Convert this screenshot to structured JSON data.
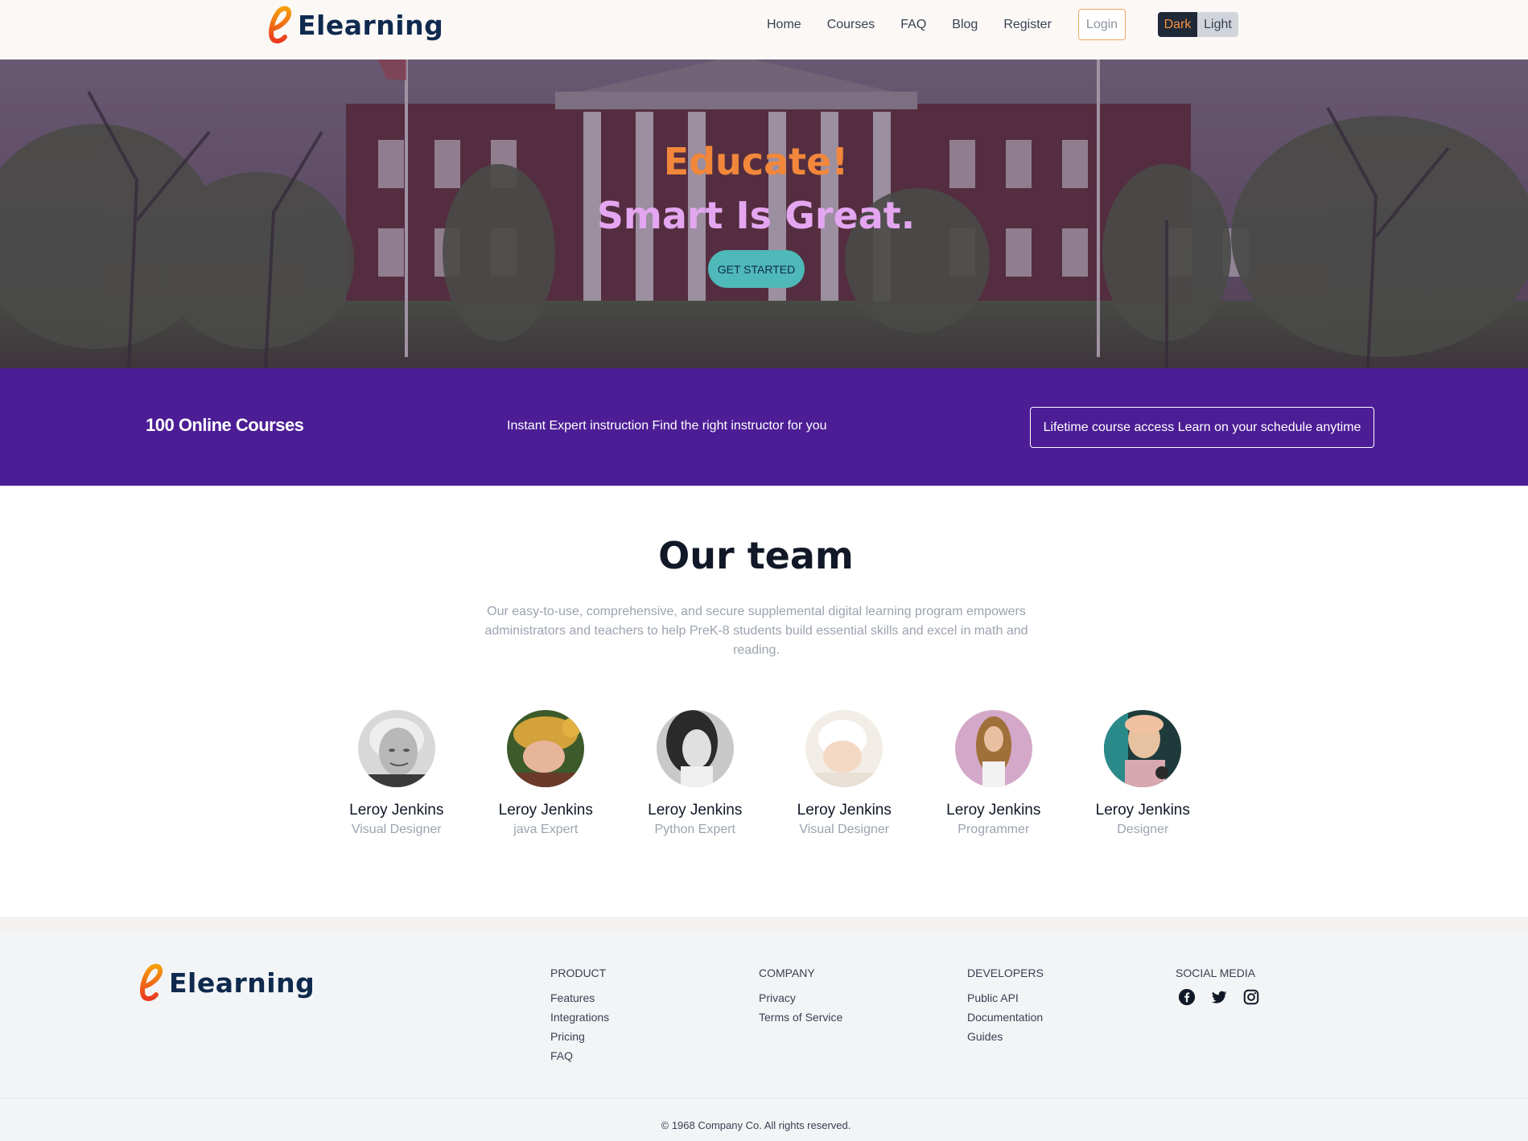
{
  "brand": {
    "name": "Elearning",
    "logo_icon": "script-e-logo"
  },
  "nav": {
    "links": [
      "Home",
      "Courses",
      "FAQ",
      "Blog",
      "Register"
    ],
    "login": "Login",
    "theme": {
      "dark": "Dark",
      "light": "Light"
    }
  },
  "hero": {
    "title_line1": "Educate!",
    "title_line2": "Smart Is Great.",
    "cta": "GET STARTED"
  },
  "stats": {
    "courses": "100 Online Courses",
    "instruction": "Instant Expert instruction Find the right instructor for you",
    "access": "Lifetime course access Learn on your schedule anytime"
  },
  "team": {
    "title": "Our team",
    "description": "Our easy-to-use, comprehensive, and secure supplemental digital learning program empowers administrators and teachers to help PreK-8 students build essential skills and excel in math and reading.",
    "members": [
      {
        "name": "Leroy Jenkins",
        "role": "Visual Designer"
      },
      {
        "name": "Leroy Jenkins",
        "role": "java Expert"
      },
      {
        "name": "Leroy Jenkins",
        "role": "Python Expert"
      },
      {
        "name": "Leroy Jenkins",
        "role": "Visual Designer"
      },
      {
        "name": "Leroy Jenkins",
        "role": "Programmer"
      },
      {
        "name": "Leroy Jenkins",
        "role": "Designer"
      }
    ]
  },
  "footer": {
    "product": {
      "title": "PRODUCT",
      "items": [
        "Features",
        "Integrations",
        "Pricing",
        "FAQ"
      ]
    },
    "company": {
      "title": "COMPANY",
      "items": [
        "Privacy",
        "Terms of Service"
      ]
    },
    "developers": {
      "title": "DEVELOPERS",
      "items": [
        "Public API",
        "Documentation",
        "Guides"
      ]
    },
    "social": {
      "title": "SOCIAL MEDIA",
      "icons": [
        "facebook-icon",
        "twitter-icon",
        "instagram-icon"
      ]
    },
    "copyright": "© 1968 Company Co. All rights reserved."
  },
  "colors": {
    "accent_orange": "#f2873b",
    "accent_pink": "#e4a6f0",
    "band_purple": "#4c1d95",
    "cta_teal": "#4fb8b8",
    "brand_navy": "#0f2a4e"
  }
}
